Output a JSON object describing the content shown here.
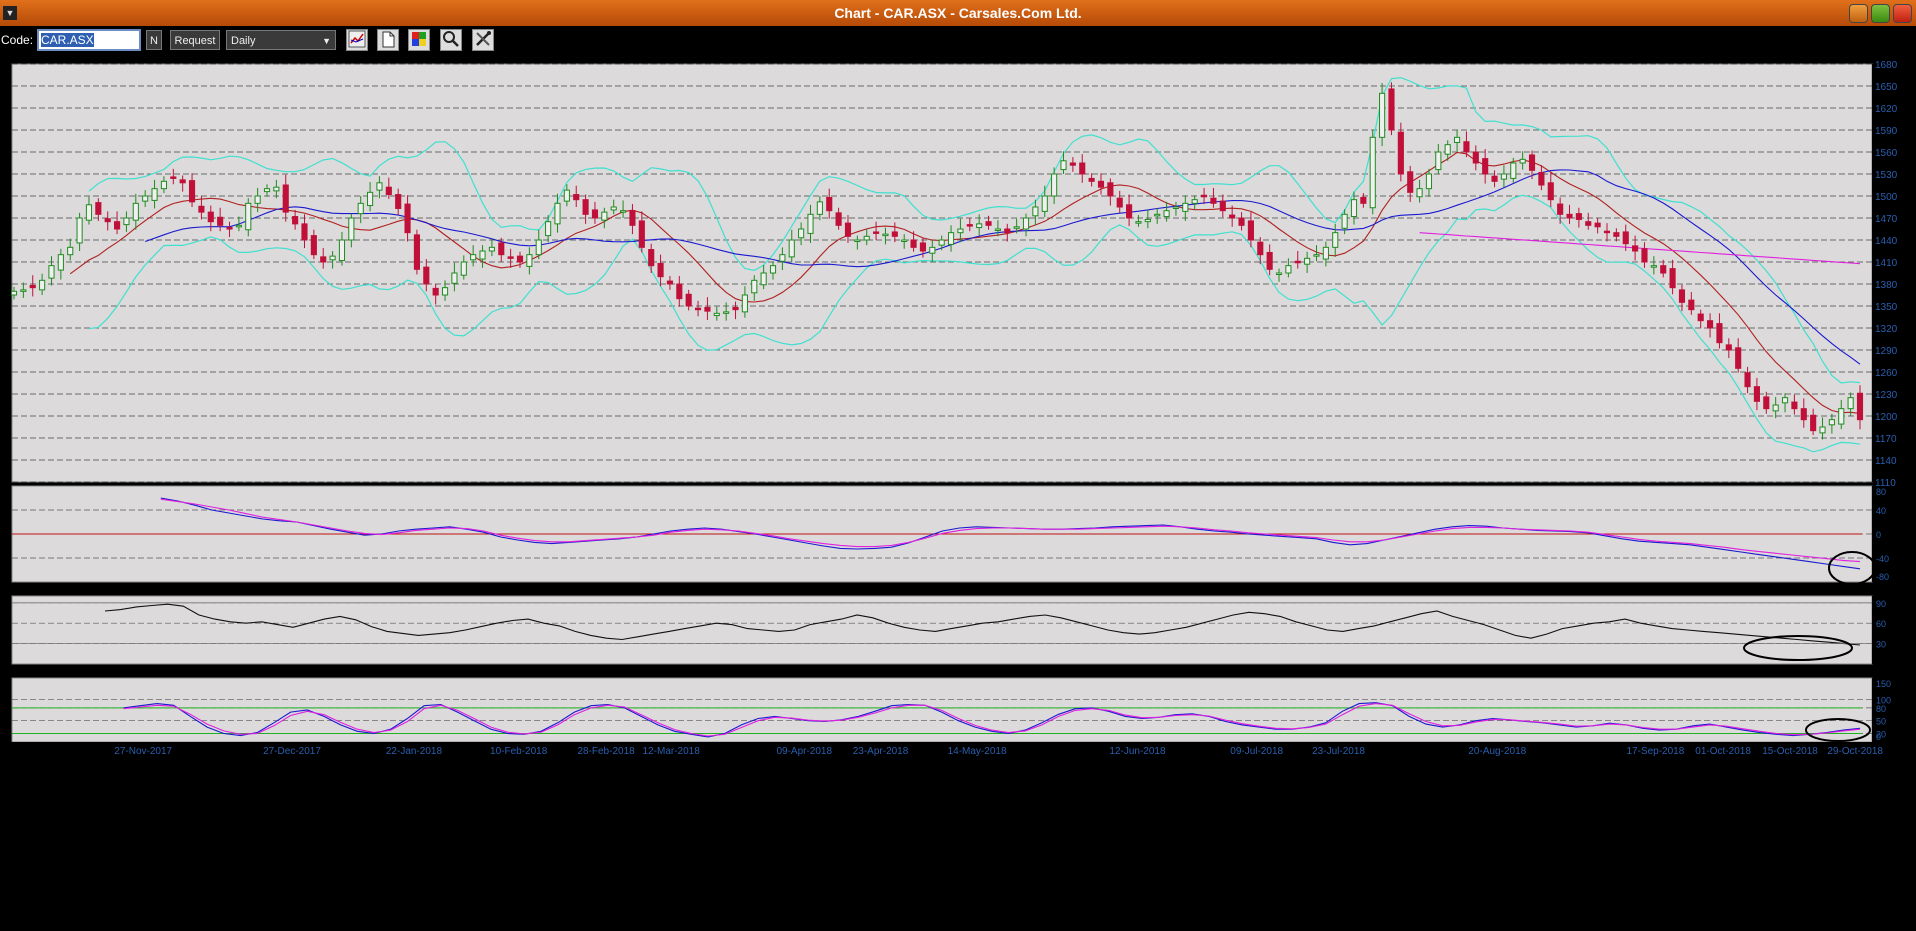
{
  "window": {
    "title": "Chart - CAR.ASX - Carsales.Com Ltd."
  },
  "toolbar": {
    "code_label": "Code:",
    "code_value": "CAR.ASX",
    "n_label": "N",
    "request_label": "Request",
    "period_value": "Daily",
    "icons": [
      "chart-type-icon",
      "page-icon",
      "color-palette-icon",
      "zoom-icon",
      "settings-tools-icon"
    ]
  },
  "colors": {
    "bull_candle": "#1e8c1e",
    "bear_candle": "#c0103a",
    "bollinger": "#40e0d0",
    "ma_short": "#b02020",
    "ma_medium": "#1a1ad0",
    "ma_long": "#e020e0",
    "panel_bg": "#dcdada",
    "axis_text": "#2a5fb0"
  },
  "chart_data": [
    {
      "type": "line",
      "title": "",
      "subtitle": "candlestick price chart with Bollinger bands and moving averages",
      "ylim": [
        1110,
        1680
      ],
      "yticks": [
        1110,
        1140,
        1170,
        1200,
        1230,
        1260,
        1290,
        1320,
        1350,
        1380,
        1410,
        1440,
        1470,
        1500,
        1530,
        1560,
        1590,
        1620,
        1650,
        1680
      ],
      "x_labels": [
        "27-Nov-2017",
        "27-Dec-2017",
        "22-Jan-2018",
        "10-Feb-2018",
        "28-Feb-2018",
        "12-Mar-2018",
        "09-Apr-2018",
        "23-Apr-2018",
        "14-May-2018",
        "12-Jun-2018",
        "09-Jul-2018",
        "23-Jul-2018",
        "20-Aug-2018",
        "17-Sep-2018",
        "01-Oct-2018",
        "15-Oct-2018",
        "29-Oct-2018"
      ],
      "close": [
        1370,
        1372,
        1375,
        1385,
        1405,
        1420,
        1430,
        1470,
        1488,
        1475,
        1465,
        1455,
        1470,
        1490,
        1500,
        1510,
        1520,
        1525,
        1518,
        1492,
        1478,
        1465,
        1460,
        1455,
        1460,
        1490,
        1500,
        1510,
        1512,
        1478,
        1462,
        1440,
        1420,
        1410,
        1418,
        1440,
        1470,
        1490,
        1505,
        1518,
        1502,
        1483,
        1450,
        1400,
        1380,
        1365,
        1375,
        1395,
        1410,
        1420,
        1425,
        1430,
        1420,
        1415,
        1410,
        1420,
        1440,
        1465,
        1490,
        1508,
        1495,
        1475,
        1470,
        1478,
        1485,
        1480,
        1460,
        1430,
        1405,
        1390,
        1380,
        1360,
        1350,
        1345,
        1343,
        1340,
        1342,
        1345,
        1365,
        1385,
        1395,
        1405,
        1420,
        1440,
        1455,
        1475,
        1492,
        1480,
        1460,
        1445,
        1440,
        1445,
        1450,
        1448,
        1445,
        1440,
        1430,
        1425,
        1430,
        1440,
        1450,
        1455,
        1460,
        1462,
        1460,
        1455,
        1450,
        1458,
        1470,
        1485,
        1500,
        1530,
        1548,
        1542,
        1530,
        1520,
        1512,
        1500,
        1485,
        1470,
        1465,
        1468,
        1475,
        1480,
        1485,
        1490,
        1495,
        1500,
        1490,
        1480,
        1470,
        1460,
        1440,
        1420,
        1400,
        1395,
        1405,
        1410,
        1415,
        1420,
        1430,
        1450,
        1475,
        1495,
        1490,
        1580,
        1640,
        1590,
        1530,
        1505,
        1510,
        1530,
        1560,
        1570,
        1580,
        1560,
        1545,
        1530,
        1520,
        1530,
        1545,
        1550,
        1535,
        1515,
        1495,
        1475,
        1470,
        1468,
        1460,
        1458,
        1450,
        1445,
        1435,
        1425,
        1410,
        1405,
        1395,
        1375,
        1355,
        1345,
        1330,
        1320,
        1300,
        1290,
        1265,
        1240,
        1220,
        1210,
        1215,
        1225,
        1210,
        1195,
        1180,
        1185,
        1195,
        1210,
        1225,
        1195
      ],
      "series": [
        {
          "name": "Price (candlestick)"
        },
        {
          "name": "Bollinger upper band"
        },
        {
          "name": "Bollinger lower band"
        },
        {
          "name": "Short moving average"
        },
        {
          "name": "Medium moving average"
        },
        {
          "name": "Long moving average"
        }
      ],
      "grid": true
    },
    {
      "type": "line",
      "subtitle": "momentum oscillator",
      "ylim": [
        -80,
        80
      ],
      "yticks": [
        -80,
        -40,
        0,
        40,
        80
      ],
      "reference_line": 0,
      "series": [
        {
          "name": "oscillator",
          "values": [
            60,
            55,
            48,
            40,
            35,
            30,
            25,
            22,
            20,
            14,
            8,
            3,
            -2,
            0,
            5,
            8,
            10,
            12,
            8,
            3,
            -5,
            -10,
            -14,
            -16,
            -14,
            -12,
            -10,
            -8,
            -5,
            0,
            5,
            8,
            10,
            8,
            4,
            0,
            -5,
            -10,
            -15,
            -20,
            -24,
            -25,
            -24,
            -22,
            -15,
            -5,
            5,
            10,
            12,
            11,
            10,
            9,
            8,
            8,
            9,
            10,
            12,
            13,
            14,
            15,
            12,
            8,
            5,
            3,
            0,
            -2,
            -4,
            -6,
            -8,
            -14,
            -18,
            -16,
            -10,
            -4,
            2,
            8,
            12,
            14,
            13,
            10,
            8,
            6,
            5,
            4,
            2,
            -3,
            -8,
            -12,
            -14,
            -16,
            -18,
            -22,
            -26,
            -30,
            -34,
            -38,
            -42,
            -46,
            -50,
            -54,
            -58
          ]
        },
        {
          "name": "signal",
          "values": [
            58,
            54,
            50,
            45,
            40,
            34,
            28,
            24,
            20,
            15,
            10,
            5,
            1,
            -1,
            2,
            6,
            8,
            10,
            9,
            5,
            -2,
            -7,
            -11,
            -13,
            -13,
            -11,
            -9,
            -7,
            -5,
            -2,
            3,
            6,
            8,
            7,
            5,
            1,
            -3,
            -8,
            -12,
            -16,
            -19,
            -21,
            -21,
            -19,
            -14,
            -7,
            1,
            6,
            9,
            10,
            10,
            9,
            8,
            8,
            8,
            9,
            10,
            11,
            12,
            13,
            12,
            10,
            7,
            5,
            2,
            0,
            -2,
            -4,
            -6,
            -10,
            -13,
            -13,
            -10,
            -5,
            0,
            5,
            9,
            11,
            11,
            10,
            8,
            7,
            6,
            5,
            3,
            -1,
            -5,
            -9,
            -12,
            -14,
            -16,
            -19,
            -22,
            -26,
            -29,
            -32,
            -35,
            -38,
            -41,
            -44,
            -46
          ]
        }
      ]
    },
    {
      "type": "line",
      "subtitle": "relative strength",
      "ylim": [
        0,
        100
      ],
      "yticks": [
        30,
        60,
        90
      ],
      "series": [
        {
          "name": "rsi",
          "values": [
            78,
            80,
            84,
            86,
            88,
            85,
            72,
            66,
            62,
            60,
            62,
            58,
            54,
            60,
            66,
            70,
            65,
            55,
            48,
            45,
            42,
            44,
            46,
            50,
            55,
            60,
            64,
            66,
            60,
            56,
            48,
            42,
            38,
            36,
            40,
            44,
            48,
            52,
            56,
            60,
            58,
            52,
            50,
            48,
            50,
            58,
            62,
            66,
            72,
            68,
            60,
            54,
            50,
            48,
            52,
            56,
            60,
            62,
            66,
            70,
            72,
            68,
            62,
            56,
            50,
            46,
            44,
            46,
            50,
            54,
            60,
            66,
            72,
            76,
            74,
            70,
            62,
            56,
            50,
            48,
            52,
            56,
            62,
            68,
            74,
            78,
            70,
            64,
            58,
            50,
            42,
            38,
            44,
            52,
            56,
            60,
            62,
            66,
            60,
            56,
            52,
            50,
            48,
            46,
            44,
            42,
            40,
            38,
            36,
            34,
            32,
            30,
            28
          ]
        }
      ]
    },
    {
      "type": "line",
      "subtitle": "stochastic oscillator",
      "ylim": [
        0,
        150
      ],
      "yticks": [
        0,
        20,
        50,
        80,
        100,
        150
      ],
      "reference_lines": [
        20,
        80
      ],
      "series": [
        {
          "name": "%K",
          "values": [
            80,
            85,
            90,
            86,
            60,
            35,
            20,
            15,
            22,
            45,
            70,
            75,
            60,
            40,
            25,
            20,
            30,
            55,
            85,
            88,
            70,
            50,
            30,
            20,
            18,
            25,
            45,
            70,
            85,
            88,
            80,
            60,
            40,
            25,
            18,
            12,
            20,
            40,
            55,
            60,
            55,
            50,
            48,
            52,
            60,
            72,
            85,
            88,
            86,
            70,
            50,
            35,
            25,
            20,
            28,
            45,
            65,
            78,
            80,
            72,
            60,
            55,
            58,
            64,
            66,
            60,
            48,
            40,
            35,
            30,
            30,
            35,
            45,
            72,
            90,
            92,
            85,
            60,
            42,
            35,
            40,
            50,
            55,
            52,
            48,
            45,
            40,
            35,
            38,
            44,
            40,
            32,
            28,
            30,
            38,
            42,
            35,
            28,
            22,
            18,
            15,
            18,
            22,
            28,
            32
          ]
        },
        {
          "name": "%D",
          "values": [
            78,
            82,
            86,
            84,
            65,
            42,
            26,
            18,
            20,
            38,
            62,
            72,
            64,
            46,
            30,
            22,
            28,
            48,
            78,
            86,
            74,
            55,
            35,
            23,
            19,
            23,
            40,
            64,
            80,
            86,
            82,
            64,
            45,
            29,
            20,
            14,
            18,
            34,
            50,
            58,
            56,
            51,
            49,
            51,
            58,
            68,
            80,
            86,
            86,
            74,
            55,
            39,
            28,
            22,
            26,
            40,
            60,
            74,
            78,
            74,
            63,
            57,
            58,
            62,
            64,
            61,
            51,
            43,
            37,
            32,
            31,
            34,
            42,
            64,
            84,
            90,
            86,
            66,
            48,
            38,
            39,
            47,
            53,
            52,
            49,
            46,
            42,
            37,
            38,
            42,
            40,
            34,
            30,
            30,
            35,
            40,
            37,
            31,
            25,
            20,
            17,
            18,
            21,
            26,
            30
          ]
        }
      ]
    }
  ],
  "annotations": [
    {
      "panel": 1,
      "shape": "ellipse"
    },
    {
      "panel": 2,
      "shape": "ellipse"
    },
    {
      "panel": 3,
      "shape": "ellipse"
    }
  ]
}
